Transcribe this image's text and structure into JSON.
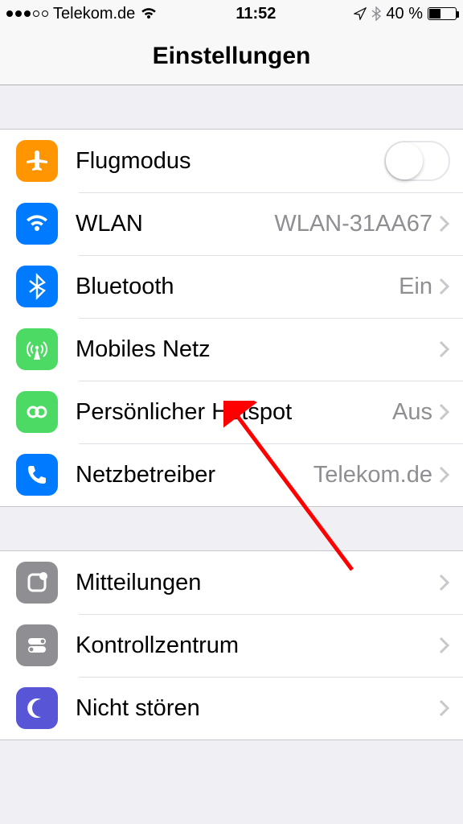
{
  "statusbar": {
    "carrier": "Telekom.de",
    "time": "11:52",
    "battery_pct": "40 %"
  },
  "navbar": {
    "title": "Einstellungen"
  },
  "group1": {
    "airplane": {
      "label": "Flugmodus"
    },
    "wifi": {
      "label": "WLAN",
      "value": "WLAN-31AA67"
    },
    "bluetooth": {
      "label": "Bluetooth",
      "value": "Ein"
    },
    "cellular": {
      "label": "Mobiles Netz"
    },
    "hotspot": {
      "label": "Persönlicher Hotspot",
      "value": "Aus"
    },
    "carrier": {
      "label": "Netzbetreiber",
      "value": "Telekom.de"
    }
  },
  "group2": {
    "notifications": {
      "label": "Mitteilungen"
    },
    "controlcenter": {
      "label": "Kontrollzentrum"
    },
    "dnd": {
      "label": "Nicht stören"
    }
  },
  "colors": {
    "orange": "#ff9500",
    "blue": "#007aff",
    "green": "#4cd964",
    "gray": "#8e8e93",
    "purple": "#5856d6"
  }
}
